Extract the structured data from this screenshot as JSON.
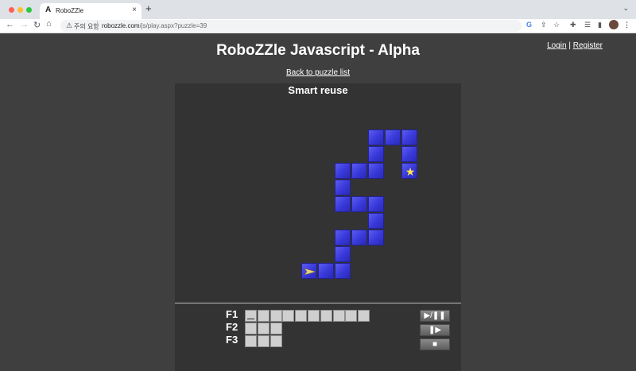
{
  "browser": {
    "tab_logo": "A",
    "tab_title": "RoboZZle",
    "tab_close": "×",
    "new_tab": "+",
    "tab_menu": "⌄",
    "nav_back": "←",
    "nav_forward": "→",
    "nav_reload": "↻",
    "nav_home": "⌂",
    "security_icon": "⚠",
    "security_text": "주의 요함",
    "url_domain": "robozzle.com",
    "url_path": "/js/play.aspx?puzzle=39",
    "icons": {
      "google": "G",
      "share": "⇪",
      "bookmark": "☆",
      "extensions": "✚",
      "reading_list": "☰",
      "side_panel": "▮",
      "menu": "⋮"
    }
  },
  "page": {
    "title": "RoboZZle Javascript - Alpha",
    "login_label": "Login",
    "auth_sep": "|",
    "register_label": "Register",
    "back_link": "Back to puzzle list"
  },
  "puzzle": {
    "name": "Smart reuse",
    "tile_color": "#4141e0",
    "star_color": "#ffe94a",
    "robot_facing": "right",
    "tiles": [
      [
        3,
        0
      ],
      [
        4,
        0
      ],
      [
        5,
        0
      ],
      [
        3,
        1
      ],
      [
        5,
        1
      ],
      [
        1,
        2
      ],
      [
        2,
        2
      ],
      [
        3,
        2
      ],
      [
        5,
        2
      ],
      [
        1,
        3
      ],
      [
        1,
        4
      ],
      [
        2,
        4
      ],
      [
        3,
        4
      ],
      [
        3,
        5
      ],
      [
        1,
        6
      ],
      [
        2,
        6
      ],
      [
        3,
        6
      ],
      [
        1,
        7
      ],
      [
        -1,
        8
      ],
      [
        0,
        8
      ],
      [
        1,
        8
      ]
    ],
    "star_tile": [
      5,
      2
    ],
    "robot_tile": [
      -1,
      8
    ]
  },
  "program": {
    "functions": [
      {
        "label": "F1",
        "slots": 10
      },
      {
        "label": "F2",
        "slots": 3
      },
      {
        "label": "F3",
        "slots": 3
      }
    ]
  },
  "controls": {
    "play_pause": "▶/❚❚",
    "step": "❚▶",
    "stop": "■"
  },
  "colors": {
    "page_bg": "#3f3f3f",
    "panel_bg": "#333333",
    "slot": "#cfcfcf"
  }
}
